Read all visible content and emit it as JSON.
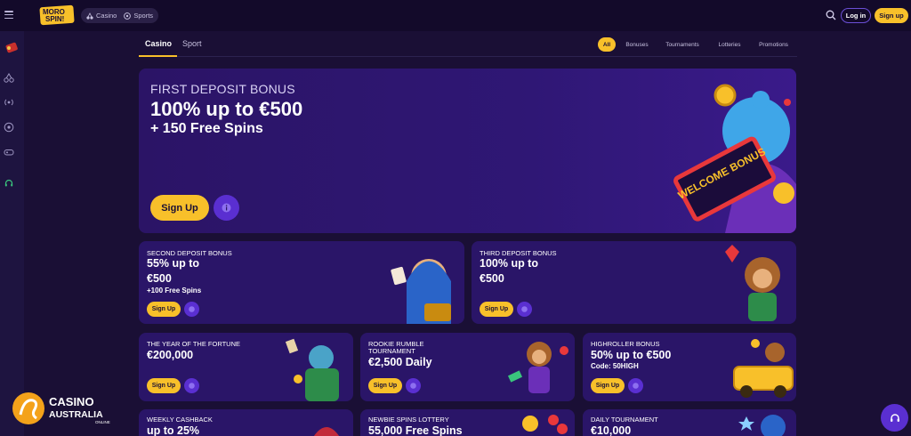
{
  "header": {
    "logo_text": "MORO SPIN!",
    "nav": {
      "casino_label": "Casino",
      "sports_label": "Sports"
    },
    "login_label": "Log in",
    "signup_label": "Sign up"
  },
  "tabs": {
    "casino_label": "Casino",
    "sport_label": "Sport"
  },
  "filters": {
    "all": "All",
    "bonuses": "Bonuses",
    "tournaments": "Tournaments",
    "lotteries": "Lotteries",
    "promotions": "Promotions"
  },
  "hero": {
    "kicker": "FIRST DEPOSIT BONUS",
    "headline": "100% up to €500",
    "subline": "+ 150 Free Spins",
    "cta_label": "Sign Up",
    "badge_text": "WELCOME BONUS"
  },
  "cards": [
    {
      "title": "SECOND DEPOSIT BONUS",
      "line1": "55% up to",
      "line2": "€500",
      "sub": "+100 Free Spins",
      "cta": "Sign Up"
    },
    {
      "title": "THIRD DEPOSIT BONUS",
      "line1": "100% up to",
      "line2": "€500",
      "cta": "Sign Up"
    },
    {
      "title": "THE YEAR OF THE FORTUNE",
      "line1": "€200,000",
      "cta": "Sign Up"
    },
    {
      "title_1": "ROOKIE RUMBLE",
      "title_2": "TOURNAMENT",
      "line1": "€2,500 Daily",
      "cta": "Sign Up"
    },
    {
      "title": "HIGHROLLER BONUS",
      "line1": "50% up to €500",
      "sub": "Code: 50HIGH",
      "cta": "Sign Up"
    },
    {
      "title": "WEEKLY CASHBACK",
      "line1": "up to 25%"
    },
    {
      "title": "NEWBIE SPINS LOTTERY",
      "line1": "55,000 Free Spins"
    },
    {
      "title": "DAILY TOURNAMENT",
      "line1": "€10,000"
    }
  ],
  "watermark": {
    "line1": "CASINO",
    "line2": "AUSTRALIA",
    "line3": "ONLINE"
  },
  "colors": {
    "bg": "#1a0f35",
    "card": "#2a1568",
    "accent_yellow": "#f8c02a",
    "accent_purple": "#5a2fd1"
  }
}
